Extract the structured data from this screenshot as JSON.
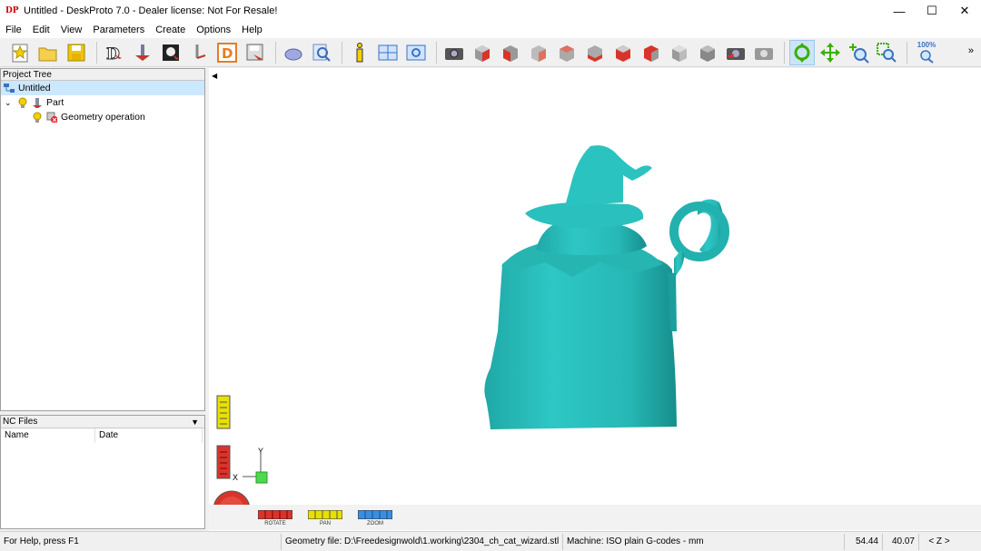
{
  "window": {
    "app_icon_text": "DP",
    "title": "Untitled - DeskProto 7.0 - Dealer license: Not For Resale!",
    "minimize": "—",
    "maximize": "☐",
    "close": "✕"
  },
  "menu": [
    "File",
    "Edit",
    "View",
    "Parameters",
    "Create",
    "Options",
    "Help"
  ],
  "toolbar": {
    "zoom_percent": "100%",
    "overflow": "»",
    "accent": "#2aa198"
  },
  "project_tree": {
    "header": "Project Tree",
    "root": "Untitled",
    "part": "Part",
    "operation": "Geometry operation"
  },
  "nc_files": {
    "header": "NC Files",
    "columns": [
      "Name",
      "Date"
    ]
  },
  "viewport": {
    "axis_y": "Y",
    "axis_x": "X",
    "nav": {
      "rotate": "ROTATE",
      "pan": "PAN",
      "zoom": "ZOOM"
    },
    "model_color": "#2ec7c4"
  },
  "status": {
    "help": "For Help, press F1",
    "geometry_file": "Geometry file: D:\\Freedesignwold\\1.working\\2304_ch_cat_wizard.stl",
    "machine": "Machine: ISO plain G-codes - mm",
    "x": "54.44",
    "y": "40.07",
    "axis": "< Z >"
  }
}
